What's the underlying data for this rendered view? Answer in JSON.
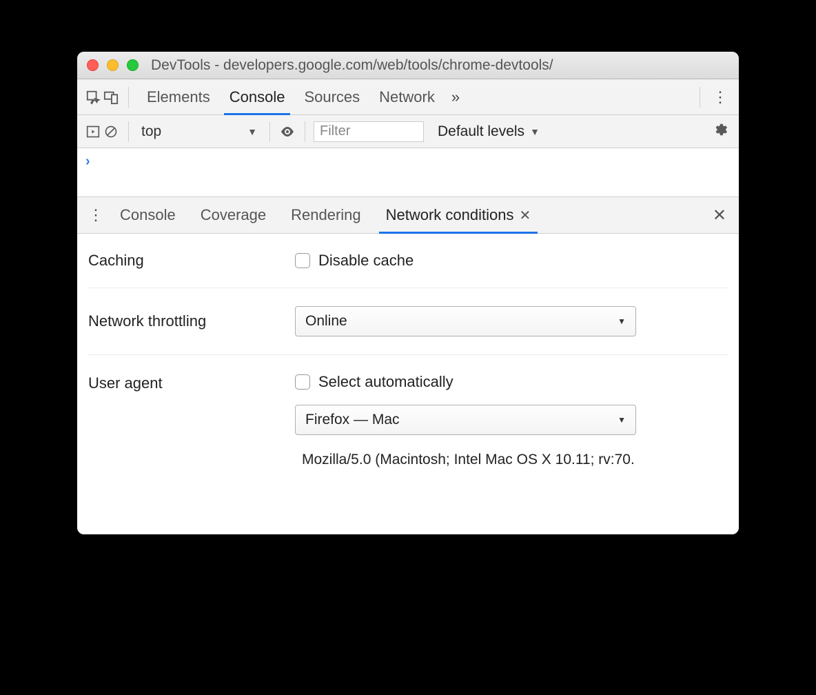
{
  "window": {
    "title": "DevTools - developers.google.com/web/tools/chrome-devtools/"
  },
  "maintabs": {
    "items": [
      "Elements",
      "Console",
      "Sources",
      "Network"
    ],
    "active": "Console"
  },
  "consolebar": {
    "context": "top",
    "filter_placeholder": "Filter",
    "levels": "Default levels"
  },
  "drawer": {
    "tabs": [
      "Console",
      "Coverage",
      "Rendering",
      "Network conditions"
    ],
    "active": "Network conditions"
  },
  "panel": {
    "caching": {
      "label": "Caching",
      "checkbox_label": "Disable cache"
    },
    "throttling": {
      "label": "Network throttling",
      "value": "Online"
    },
    "useragent": {
      "label": "User agent",
      "checkbox_label": "Select automatically",
      "select_value": "Firefox — Mac",
      "ua_string": "Mozilla/5.0 (Macintosh; Intel Mac OS X 10.11; rv:70."
    }
  }
}
